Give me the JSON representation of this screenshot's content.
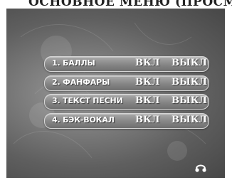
{
  "header": {
    "partial_text": "ОСНОВНОЕ МЕНЮ (ПРОСМ"
  },
  "menu": {
    "items": [
      {
        "label": "1. БАЛЛЫ",
        "on_label": "ВКЛ",
        "off_label": "ВЫКЛ"
      },
      {
        "label": "2. ФАНФАРЫ",
        "on_label": "ВКЛ",
        "off_label": "ВЫКЛ"
      },
      {
        "label": "3. ТЕКСТ ПЕСНИ",
        "on_label": "ВКЛ",
        "off_label": "ВЫКЛ"
      },
      {
        "label": "4. БЭК-ВОКАЛ",
        "on_label": "ВКЛ",
        "off_label": "ВЫКЛ"
      }
    ]
  },
  "icons": {
    "status": "headphones-icon"
  },
  "colors": {
    "screen_bg": "#6f6f6f",
    "button_bg": "#8c8c8c",
    "text": "#ffffff"
  }
}
